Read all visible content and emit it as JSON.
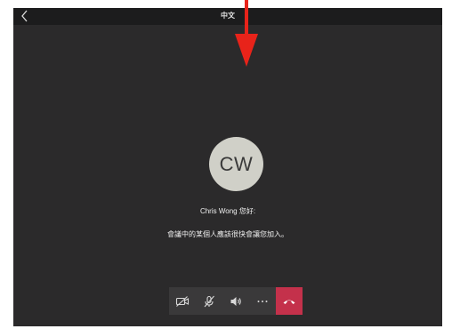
{
  "header": {
    "title": "中文"
  },
  "participant": {
    "initials": "CW",
    "greeting": "Chris Wong 您好:"
  },
  "status": {
    "message": "會議中的某個人應該很快會讓您加入。"
  },
  "controls": {
    "items": [
      "camera-off-icon",
      "microphone-off-icon",
      "speaker-icon",
      "more-icon",
      "hang-up-icon"
    ],
    "more_label": "···",
    "hangup_color": "#c4314b"
  },
  "annotation": {
    "arrow_color": "#e8231a"
  }
}
